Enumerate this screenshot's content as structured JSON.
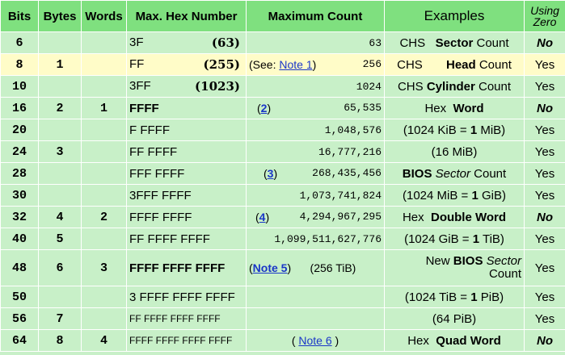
{
  "headers": {
    "bits": "Bits",
    "bytes": "Bytes",
    "words": "Words",
    "max_hex": "Max. Hex Number",
    "max_count": "Maximum Count",
    "examples": "Examples",
    "zero_1": "Using",
    "zero_2": "Zero"
  },
  "rows": [
    {
      "bits": "6",
      "bytes": "",
      "words": "",
      "hex": "3F",
      "dec": "(63)",
      "count": "63",
      "note": "",
      "ex_pre": "CHS",
      "ex_bold": "Sector",
      "ex_post": " Count",
      "zero": "No"
    },
    {
      "bits": "8",
      "bytes": "1",
      "words": "",
      "hex": "FF",
      "dec": "(255)",
      "count": "256",
      "note_pre": "(See: ",
      "note_link": "Note 1",
      "note_post": ")",
      "ex_pre": "CHS",
      "ex_bold": "Head",
      "ex_post": " Count",
      "zero": "Yes"
    },
    {
      "bits": "10",
      "bytes": "",
      "words": "",
      "hex": "3FF",
      "dec": "(1023)",
      "count": "1024",
      "ex_pre": "CHS ",
      "ex_bold": "Cylinder",
      "ex_post": " Count",
      "zero": "Yes"
    },
    {
      "bits": "16",
      "bytes": "2",
      "words": "1",
      "hex": "FFFF",
      "dec": "",
      "count": "65,535",
      "note_link": "2",
      "ex_pre": "Hex ",
      "ex_bold": "Word",
      "ex_post": "",
      "zero": "No"
    },
    {
      "bits": "20",
      "bytes": "",
      "words": "",
      "hex": "F FFFF",
      "count": "1,048,576",
      "ex_pre": "(1024 KiB = ",
      "ex_bold": "1",
      "ex_post": " MiB)",
      "zero": "Yes"
    },
    {
      "bits": "24",
      "bytes": "3",
      "words": "",
      "hex": "FF FFFF",
      "count": "16,777,216",
      "ex_pre": "(16 MiB)",
      "ex_bold": "",
      "ex_post": "",
      "zero": "Yes"
    },
    {
      "bits": "28",
      "bytes": "",
      "words": "",
      "hex": "FFF FFFF",
      "count": "268,435,456",
      "note_link": "3",
      "ex_pre": "",
      "ex_bold": "BIOS",
      "ex_ital": "Sector",
      "ex_post": " Count",
      "zero": "Yes"
    },
    {
      "bits": "30",
      "bytes": "",
      "words": "",
      "hex": "3FFF FFFF",
      "count": "1,073,741,824",
      "ex_pre": "(1024 MiB = ",
      "ex_bold": "1",
      "ex_post": " GiB)",
      "zero": "Yes"
    },
    {
      "bits": "32",
      "bytes": "4",
      "words": "2",
      "hex": "FFFF FFFF",
      "count": "4,294,967,295",
      "note_link": "4",
      "ex_pre": "Hex ",
      "ex_bold": "Double Word",
      "ex_post": "",
      "zero": "No"
    },
    {
      "bits": "40",
      "bytes": "5",
      "words": "",
      "hex": "FF FFFF FFFF",
      "count": "1,099,511,627,776",
      "ex_pre": "(1024 GiB = ",
      "ex_bold": "1",
      "ex_post": " TiB)",
      "zero": "Yes"
    },
    {
      "bits": "48",
      "bytes": "6",
      "words": "3",
      "hex": "FFFF FFFF FFFF",
      "count": "(256 TiB)",
      "note_link": "Note 5",
      "ex_pre": "New ",
      "ex_bold": "BIOS",
      "ex_ital": "Sector",
      "ex_post": "Count",
      "zero": "Yes"
    },
    {
      "bits": "50",
      "bytes": "",
      "words": "",
      "hex": "3 FFFF FFFF FFFF",
      "count": "",
      "ex_pre": "(1024 TiB = ",
      "ex_bold": "1",
      "ex_post": " PiB)",
      "zero": "Yes"
    },
    {
      "bits": "56",
      "bytes": "7",
      "words": "",
      "hex": "FF FFFF FFFF FFFF",
      "count": "",
      "ex_pre": "(64 PiB)",
      "ex_bold": "",
      "ex_post": "",
      "zero": "Yes"
    },
    {
      "bits": "64",
      "bytes": "8",
      "words": "4",
      "hex": "FFFF FFFF FFFF FFFF",
      "count": "",
      "note_link": "Note 6",
      "ex_pre": "Hex ",
      "ex_bold": "Quad Word",
      "ex_post": "",
      "zero": "No"
    }
  ]
}
